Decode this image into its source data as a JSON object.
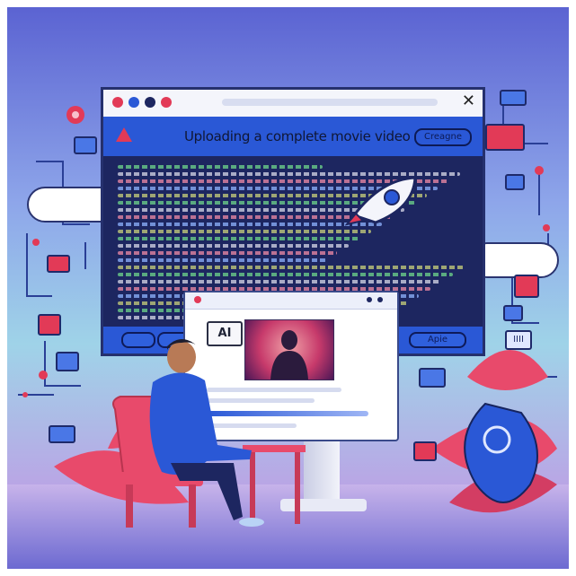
{
  "main_window": {
    "heading": "Uploading a complete movie video",
    "pill_label": "Creagnе",
    "footer_button_label": "Apie"
  },
  "small_window": {
    "badge_label": "AI"
  },
  "side_icons": {
    "right_label": "IIII"
  },
  "colors": {
    "background_top": "#5a5fcf",
    "background_bottom": "#b7bfe9",
    "accent_blue": "#2a58d6",
    "accent_red": "#e23a57",
    "dark_navy": "#1d2660"
  }
}
